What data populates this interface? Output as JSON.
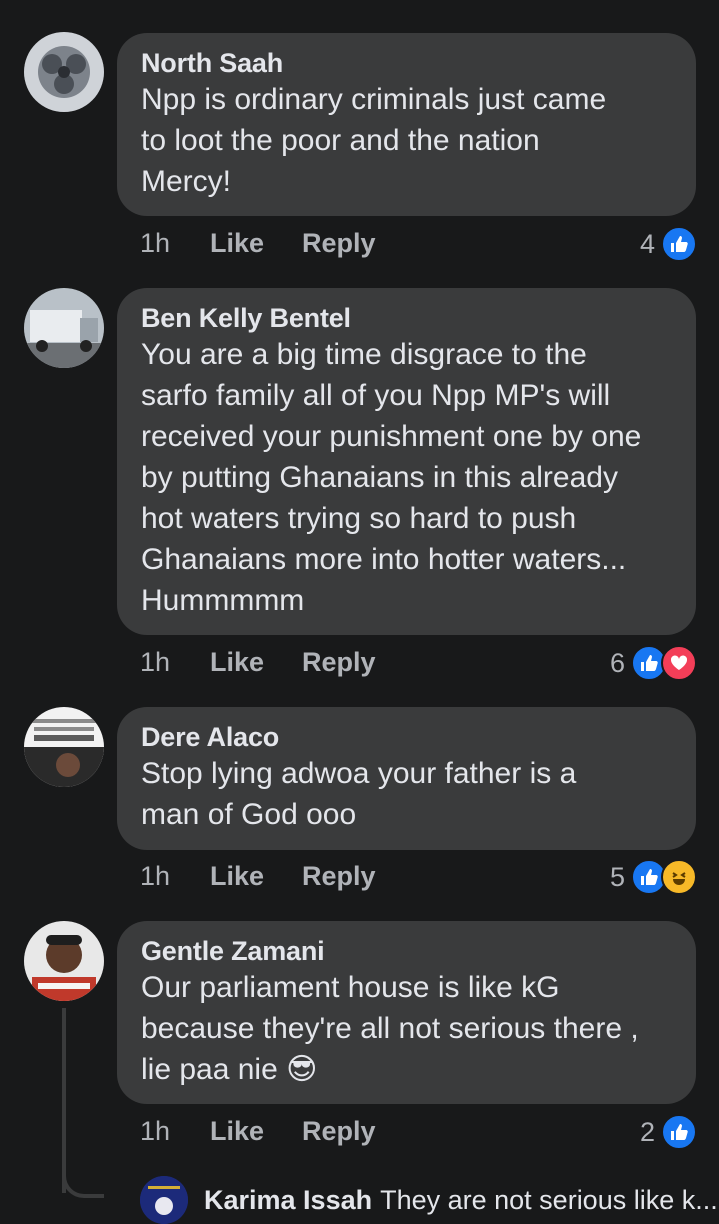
{
  "comments": [
    {
      "author": "North Saah",
      "text": "Npp is ordinary criminals just came\nto loot the poor and the nation\nMercy!",
      "time": "1h",
      "like_label": "Like",
      "reply_label": "Reply",
      "reaction_count": "4",
      "reactions": [
        "like"
      ]
    },
    {
      "author": "Ben Kelly Bentel",
      "text": "You are a big time disgrace to the\nsarfo family all of you Npp MP's will\nreceived your punishment one by one\nby putting Ghanaians in this already\nhot waters trying so hard to push\nGhanaians more into hotter waters...\nHummmmm",
      "time": "1h",
      "like_label": "Like",
      "reply_label": "Reply",
      "reaction_count": "6",
      "reactions": [
        "like",
        "love"
      ]
    },
    {
      "author": "Dere Alaco",
      "text": "Stop lying adwoa your father is a\nman of God ooo",
      "time": "1h",
      "like_label": "Like",
      "reply_label": "Reply",
      "reaction_count": "5",
      "reactions": [
        "like",
        "haha"
      ]
    },
    {
      "author": "Gentle Zamani",
      "text": "Our parliament house is like kG\nbecause they're all not serious there ,\nlie paa nie 😎",
      "time": "1h",
      "like_label": "Like",
      "reply_label": "Reply",
      "reaction_count": "2",
      "reactions": [
        "like"
      ]
    }
  ],
  "reply_preview": {
    "author": "Karima Issah",
    "text": "They are not serious like k..."
  },
  "colors": {
    "background": "#18191a",
    "bubble": "#3a3b3c",
    "like": "#1877f2",
    "love": "#f33e58",
    "haha": "#f7b928"
  }
}
